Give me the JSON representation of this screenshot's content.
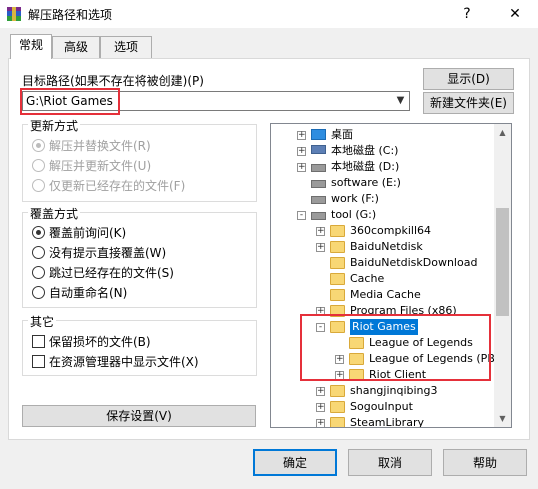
{
  "window": {
    "title": "解压路径和选项",
    "help_glyph": "?",
    "close_glyph": "✕"
  },
  "tabs": [
    {
      "label": "常规"
    },
    {
      "label": "高级"
    },
    {
      "label": "选项"
    }
  ],
  "path": {
    "label": "目标路径(如果不存在将被创建)(P)",
    "value": "G:\\Riot Games",
    "show_button": "显示(D)",
    "new_folder_button": "新建文件夹(E)"
  },
  "update_mode": {
    "title": "更新方式",
    "options": [
      {
        "label": "解压并替换文件(R)",
        "checked": true
      },
      {
        "label": "解压并更新文件(U)",
        "checked": false
      },
      {
        "label": "仅更新已经存在的文件(F)",
        "checked": false
      }
    ]
  },
  "overwrite_mode": {
    "title": "覆盖方式",
    "options": [
      {
        "label": "覆盖前询问(K)",
        "checked": true
      },
      {
        "label": "没有提示直接覆盖(W)",
        "checked": false
      },
      {
        "label": "跳过已经存在的文件(S)",
        "checked": false
      },
      {
        "label": "自动重命名(N)",
        "checked": false
      }
    ]
  },
  "misc": {
    "title": "其它",
    "options": [
      {
        "label": "保留损坏的文件(B)",
        "checked": false
      },
      {
        "label": "在资源管理器中显示文件(X)",
        "checked": false
      }
    ]
  },
  "save_button": "保存设置(V)",
  "tree": [
    {
      "label": "桌面",
      "icon": "desktop"
    },
    {
      "label": "本地磁盘 (C:)",
      "icon": "drive-win"
    },
    {
      "label": "本地磁盘 (D:)",
      "icon": "drive"
    },
    {
      "label": "software (E:)",
      "icon": "drive"
    },
    {
      "label": "work (F:)",
      "icon": "drive"
    },
    {
      "label": "tool (G:)",
      "icon": "drive"
    },
    {
      "label": "360compkill64",
      "icon": "folder"
    },
    {
      "label": "BaiduNetdisk",
      "icon": "folder"
    },
    {
      "label": "BaiduNetdiskDownload",
      "icon": "folder"
    },
    {
      "label": "Cache",
      "icon": "folder"
    },
    {
      "label": "Media Cache",
      "icon": "folder"
    },
    {
      "label": "Program Files (x86)",
      "icon": "folder"
    },
    {
      "label": "Riot Games",
      "icon": "folder",
      "selected": true
    },
    {
      "label": "League of Legends",
      "icon": "folder"
    },
    {
      "label": "League of Legends (PBE)",
      "icon": "folder"
    },
    {
      "label": "Riot Client",
      "icon": "folder"
    },
    {
      "label": "shangjinqibing3",
      "icon": "folder"
    },
    {
      "label": "SogouInput",
      "icon": "folder"
    },
    {
      "label": "SteamLibrary",
      "icon": "folder"
    }
  ],
  "buttons": {
    "ok": "确定",
    "cancel": "取消",
    "help": "帮助"
  },
  "colors": {
    "accent": "#0078d7",
    "highlight": "#e5303a"
  }
}
